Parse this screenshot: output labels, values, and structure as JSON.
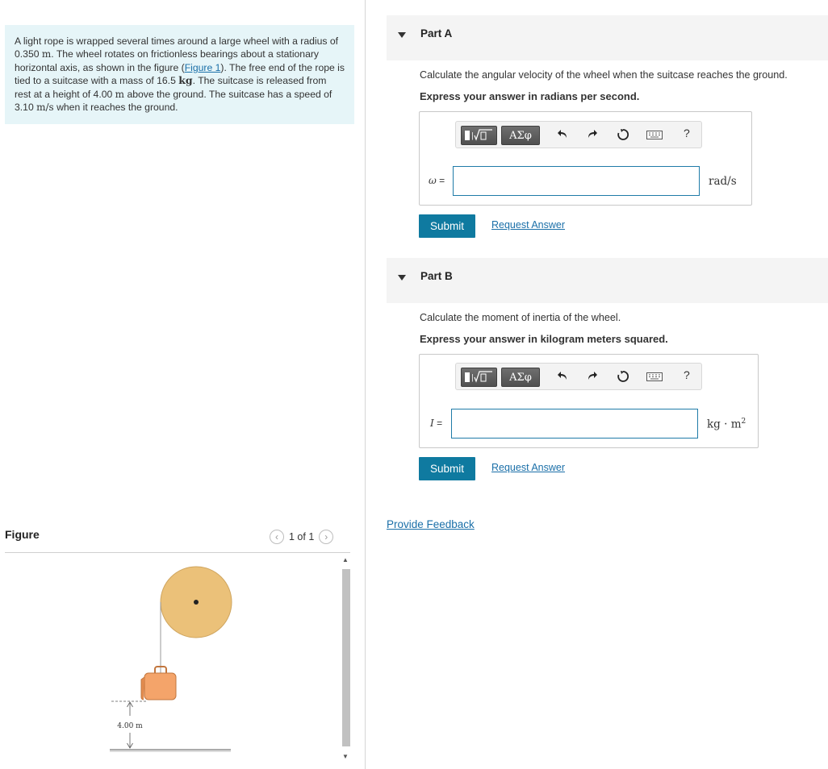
{
  "problem": {
    "t1": "A light rope is wrapped several times around a large wheel with a radius of 0.350",
    "u1": "m",
    "t2": ". The wheel rotates on frictionless bearings about a stationary horizontal axis, as shown in the figure (",
    "fig_link": "Figure 1",
    "t3": "). The free end of the rope is tied to a suitcase with a mass of 16.5",
    "u2": "kg",
    "t4": ". The suitcase is released from rest at a height of 4.00",
    "u3": "m",
    "t5": " above the ground. The suitcase has a speed of 3.10",
    "u4": "m/s",
    "t6": " when it reaches the ground."
  },
  "figure": {
    "title": "Figure",
    "pager": "1 of 1",
    "height_label": "4.00 m",
    "colors": {
      "wheel": "#ebc179",
      "suitcase": "#f4a46a"
    }
  },
  "part_a": {
    "title": "Part A",
    "question": "Calculate the angular velocity of the wheel when the suitcase reaches the ground.",
    "instruction": "Express your answer in radians per second.",
    "var_symbol": "ω",
    "var_eq": " =",
    "unit": "rad/s",
    "submit": "Submit",
    "request": "Request Answer"
  },
  "part_b": {
    "title": "Part B",
    "question": "Calculate the moment of inertia of the wheel.",
    "instruction": "Express your answer in kilogram meters squared.",
    "var_symbol": "I",
    "var_eq": " =",
    "unit_base": "kg · m",
    "unit_exp": "2",
    "submit": "Submit",
    "request": "Request Answer"
  },
  "toolbar": {
    "greek": "ΑΣφ",
    "help": "?",
    "icons": [
      "templates-icon",
      "greek-letters-icon",
      "undo-icon",
      "redo-icon",
      "reset-icon",
      "keyboard-icon",
      "help-icon"
    ]
  },
  "feedback": "Provide Feedback",
  "colors": {
    "accent": "#0f7aa0",
    "link": "#1a6fa8",
    "problem_bg": "#e6f5f8"
  }
}
